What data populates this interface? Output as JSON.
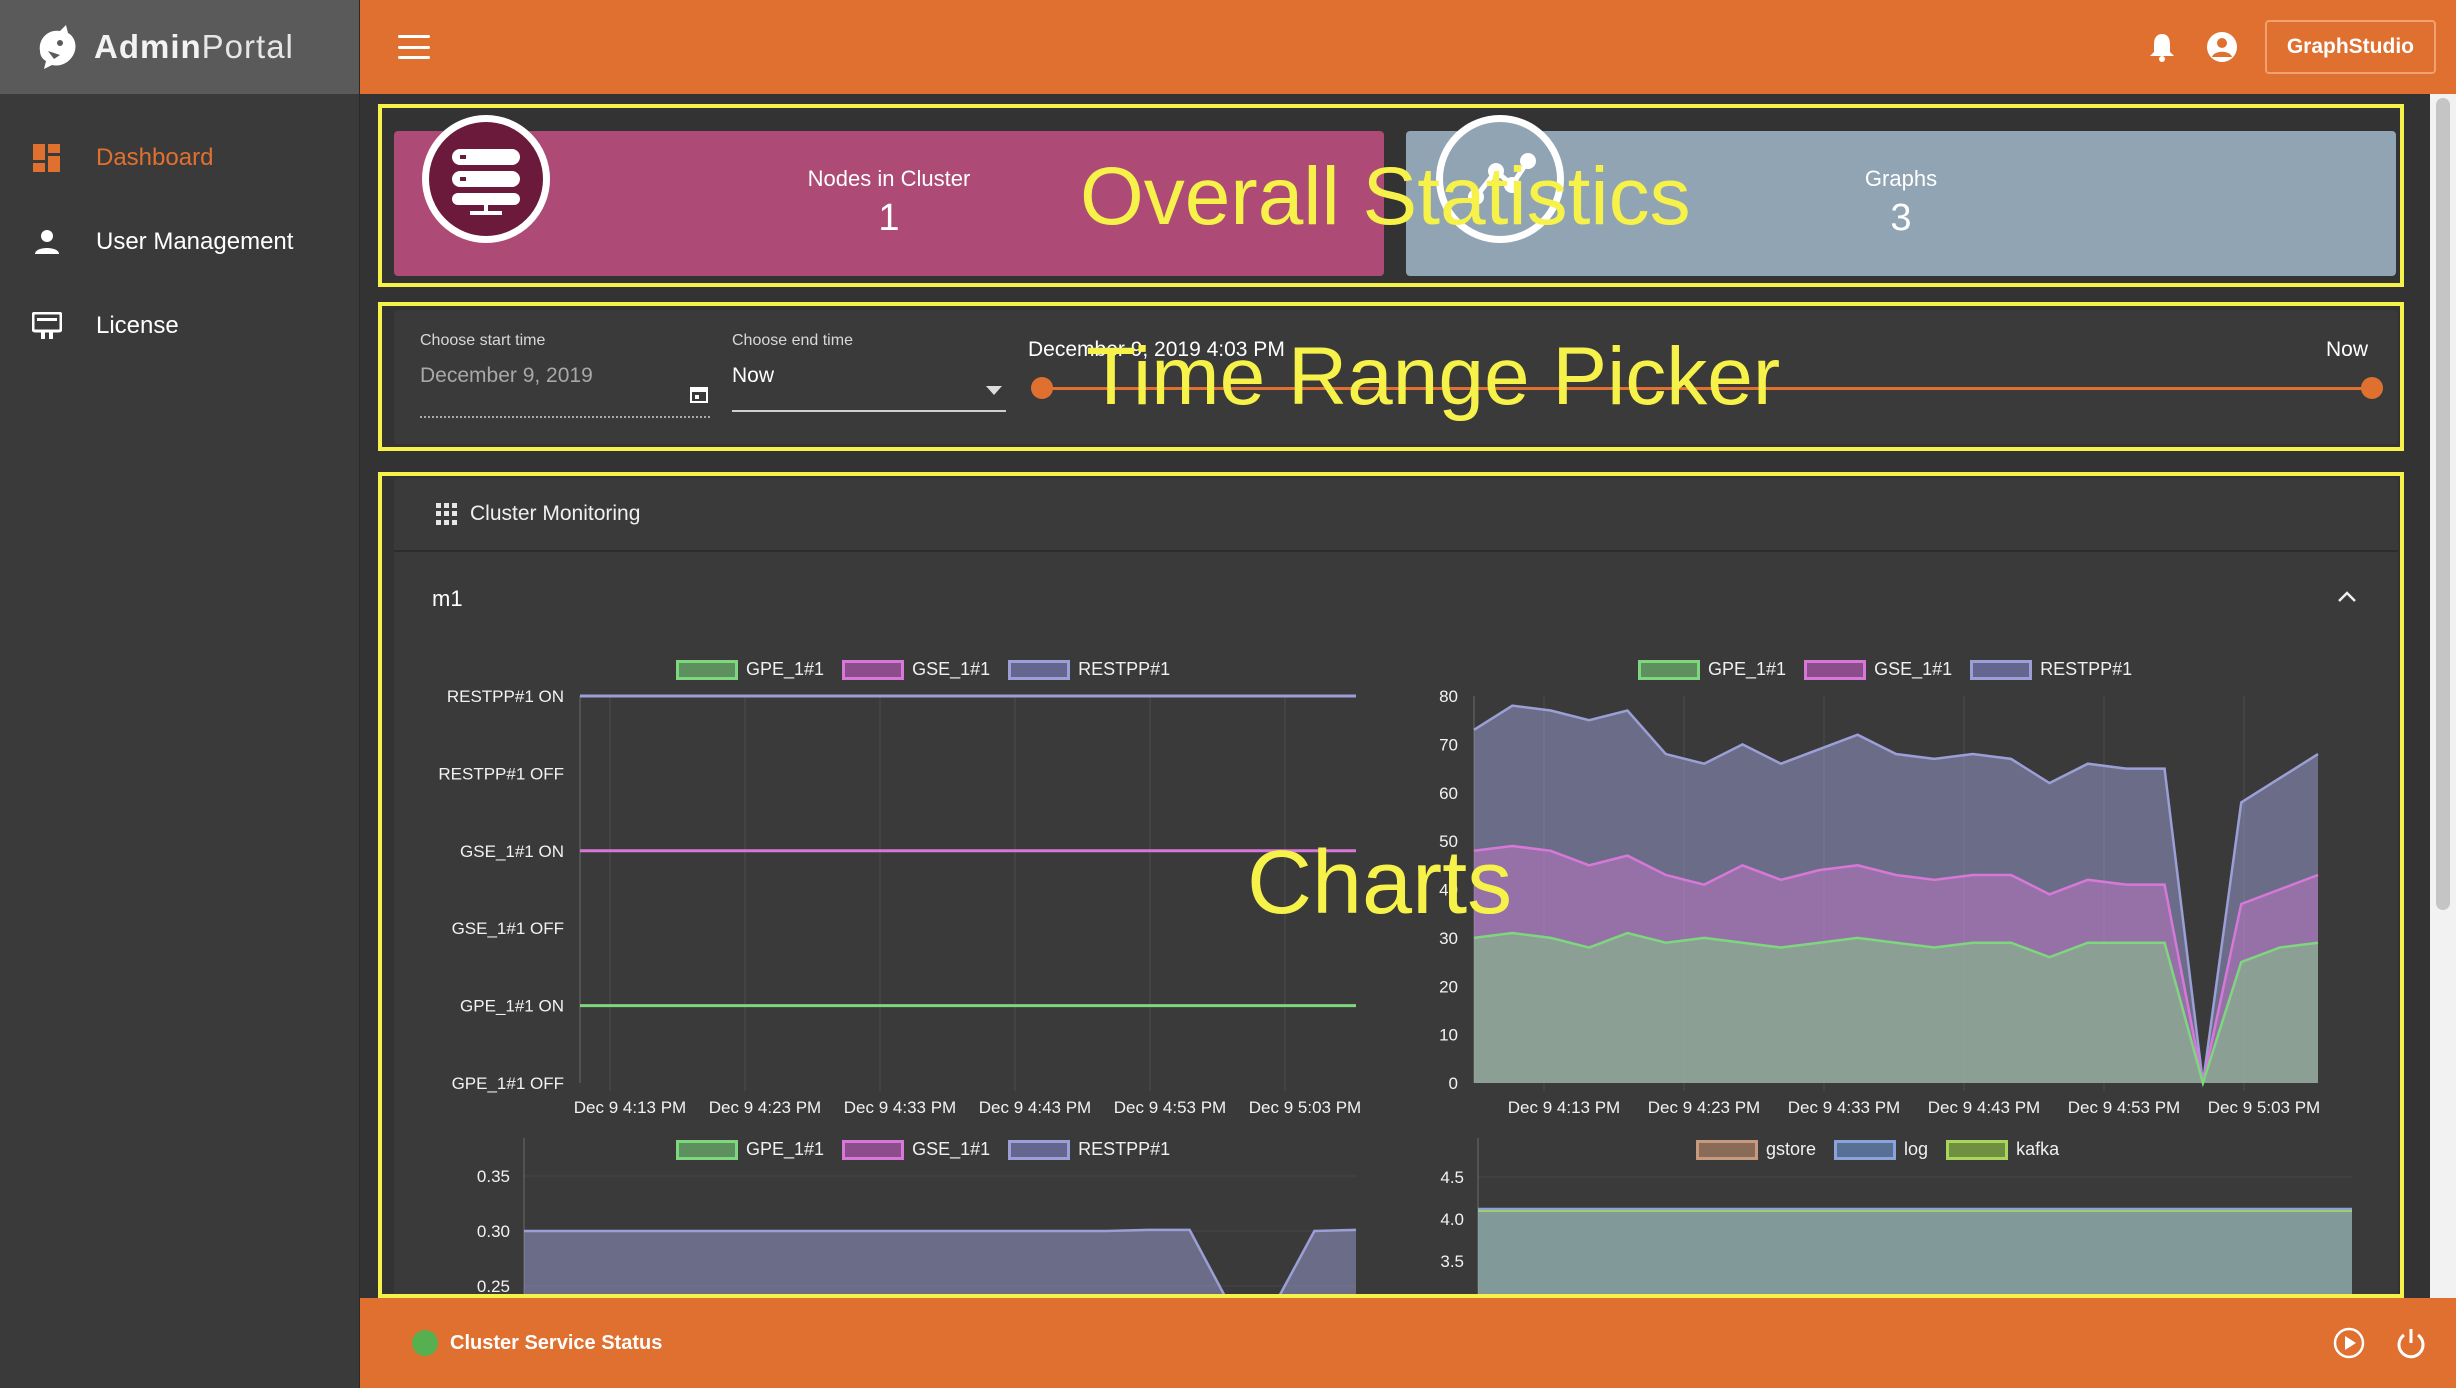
{
  "brand": {
    "bold": "Admin",
    "light": "Portal"
  },
  "sidebar": {
    "items": [
      {
        "label": "Dashboard",
        "icon": "dashboard-icon",
        "active": true
      },
      {
        "label": "User Management",
        "icon": "person-icon",
        "active": false
      },
      {
        "label": "License",
        "icon": "license-icon",
        "active": false
      }
    ]
  },
  "topbar": {
    "graphstudio_label": "GraphStudio",
    "icons": [
      "menu-icon",
      "bell-icon",
      "account-icon"
    ]
  },
  "stats": {
    "nodes": {
      "label": "Nodes in Cluster",
      "value": "1"
    },
    "graphs": {
      "label": "Graphs",
      "value": "3"
    }
  },
  "time_range": {
    "start_label": "Choose start time",
    "start_value": "December 9, 2019",
    "end_label": "Choose end time",
    "end_value": "Now",
    "range_start_text": "December 9, 2019 4:03 PM",
    "range_end_text": "Now"
  },
  "annotations": {
    "overall": "Overall Statistics",
    "time": "Time Range Picker",
    "charts": "Charts"
  },
  "monitoring": {
    "title": "Cluster Monitoring",
    "node_name": "m1"
  },
  "status": {
    "label": "Cluster Service Status",
    "color": "#57b04f"
  },
  "colors": {
    "accent": "#e07030",
    "gpe": "#7ed67e",
    "gse": "#d778d8",
    "restpp": "#9c9fd6",
    "gstore": "#c69a7e",
    "log": "#8aa3d8",
    "kafka": "#a7d65a"
  },
  "chart_data": [
    {
      "type": "line",
      "y_categories": [
        "GPE_1#1 OFF",
        "GPE_1#1 ON",
        "GSE_1#1 OFF",
        "GSE_1#1 ON",
        "RESTPP#1 OFF",
        "RESTPP#1 ON"
      ],
      "x": [
        "Dec 9 4:13 PM",
        "Dec 9 4:23 PM",
        "Dec 9 4:33 PM",
        "Dec 9 4:43 PM",
        "Dec 9 4:53 PM",
        "Dec 9 5:03 PM"
      ],
      "series": [
        {
          "name": "GPE_1#1",
          "values": [
            "GPE_1#1 ON",
            "GPE_1#1 ON"
          ]
        },
        {
          "name": "GSE_1#1",
          "values": [
            "GSE_1#1 ON",
            "GSE_1#1 ON"
          ]
        },
        {
          "name": "RESTPP#1",
          "values": [
            "RESTPP#1 ON",
            "RESTPP#1 ON"
          ]
        }
      ]
    },
    {
      "type": "area",
      "ylim": [
        0,
        80
      ],
      "yticks": [
        0,
        10,
        20,
        30,
        40,
        50,
        60,
        70,
        80
      ],
      "x": [
        "Dec 9 4:13 PM",
        "Dec 9 4:23 PM",
        "Dec 9 4:33 PM",
        "Dec 9 4:43 PM",
        "Dec 9 4:53 PM",
        "Dec 9 5:03 PM"
      ],
      "series": [
        {
          "name": "GPE_1#1",
          "values": [
            30,
            31,
            30,
            28,
            31,
            29,
            30,
            29,
            28,
            29,
            30,
            29,
            28,
            29,
            29,
            26,
            29,
            29,
            29,
            0,
            25,
            28,
            29
          ]
        },
        {
          "name": "GSE_1#1",
          "values": [
            48,
            49,
            48,
            45,
            47,
            43,
            41,
            45,
            42,
            44,
            45,
            43,
            42,
            43,
            43,
            39,
            42,
            41,
            41,
            0,
            37,
            40,
            43
          ]
        },
        {
          "name": "RESTPP#1",
          "values": [
            73,
            78,
            77,
            75,
            77,
            68,
            66,
            70,
            66,
            69,
            72,
            68,
            67,
            68,
            67,
            62,
            66,
            65,
            65,
            0,
            58,
            63,
            68
          ]
        }
      ]
    },
    {
      "type": "area",
      "yticks": [
        0.25,
        0.3,
        0.35
      ],
      "series": [
        {
          "name": "GPE_1#1",
          "values": []
        },
        {
          "name": "GSE_1#1",
          "values": []
        },
        {
          "name": "RESTPP#1",
          "values": [
            0.3,
            0.3,
            0.3,
            0.3,
            0.3,
            0.3,
            0.3,
            0.3,
            0.3,
            0.3,
            0.3,
            0.3,
            0.3,
            0.3,
            0.3,
            0.301,
            0.301,
            0.23,
            0.23,
            0.3,
            0.301
          ]
        }
      ]
    },
    {
      "type": "area",
      "yticks": [
        3.5,
        4.0,
        4.5
      ],
      "series": [
        {
          "name": "gstore",
          "values": []
        },
        {
          "name": "log",
          "values": [
            4.0,
            4.0
          ]
        },
        {
          "name": "kafka",
          "values": [
            4.1,
            4.1
          ]
        }
      ]
    }
  ]
}
